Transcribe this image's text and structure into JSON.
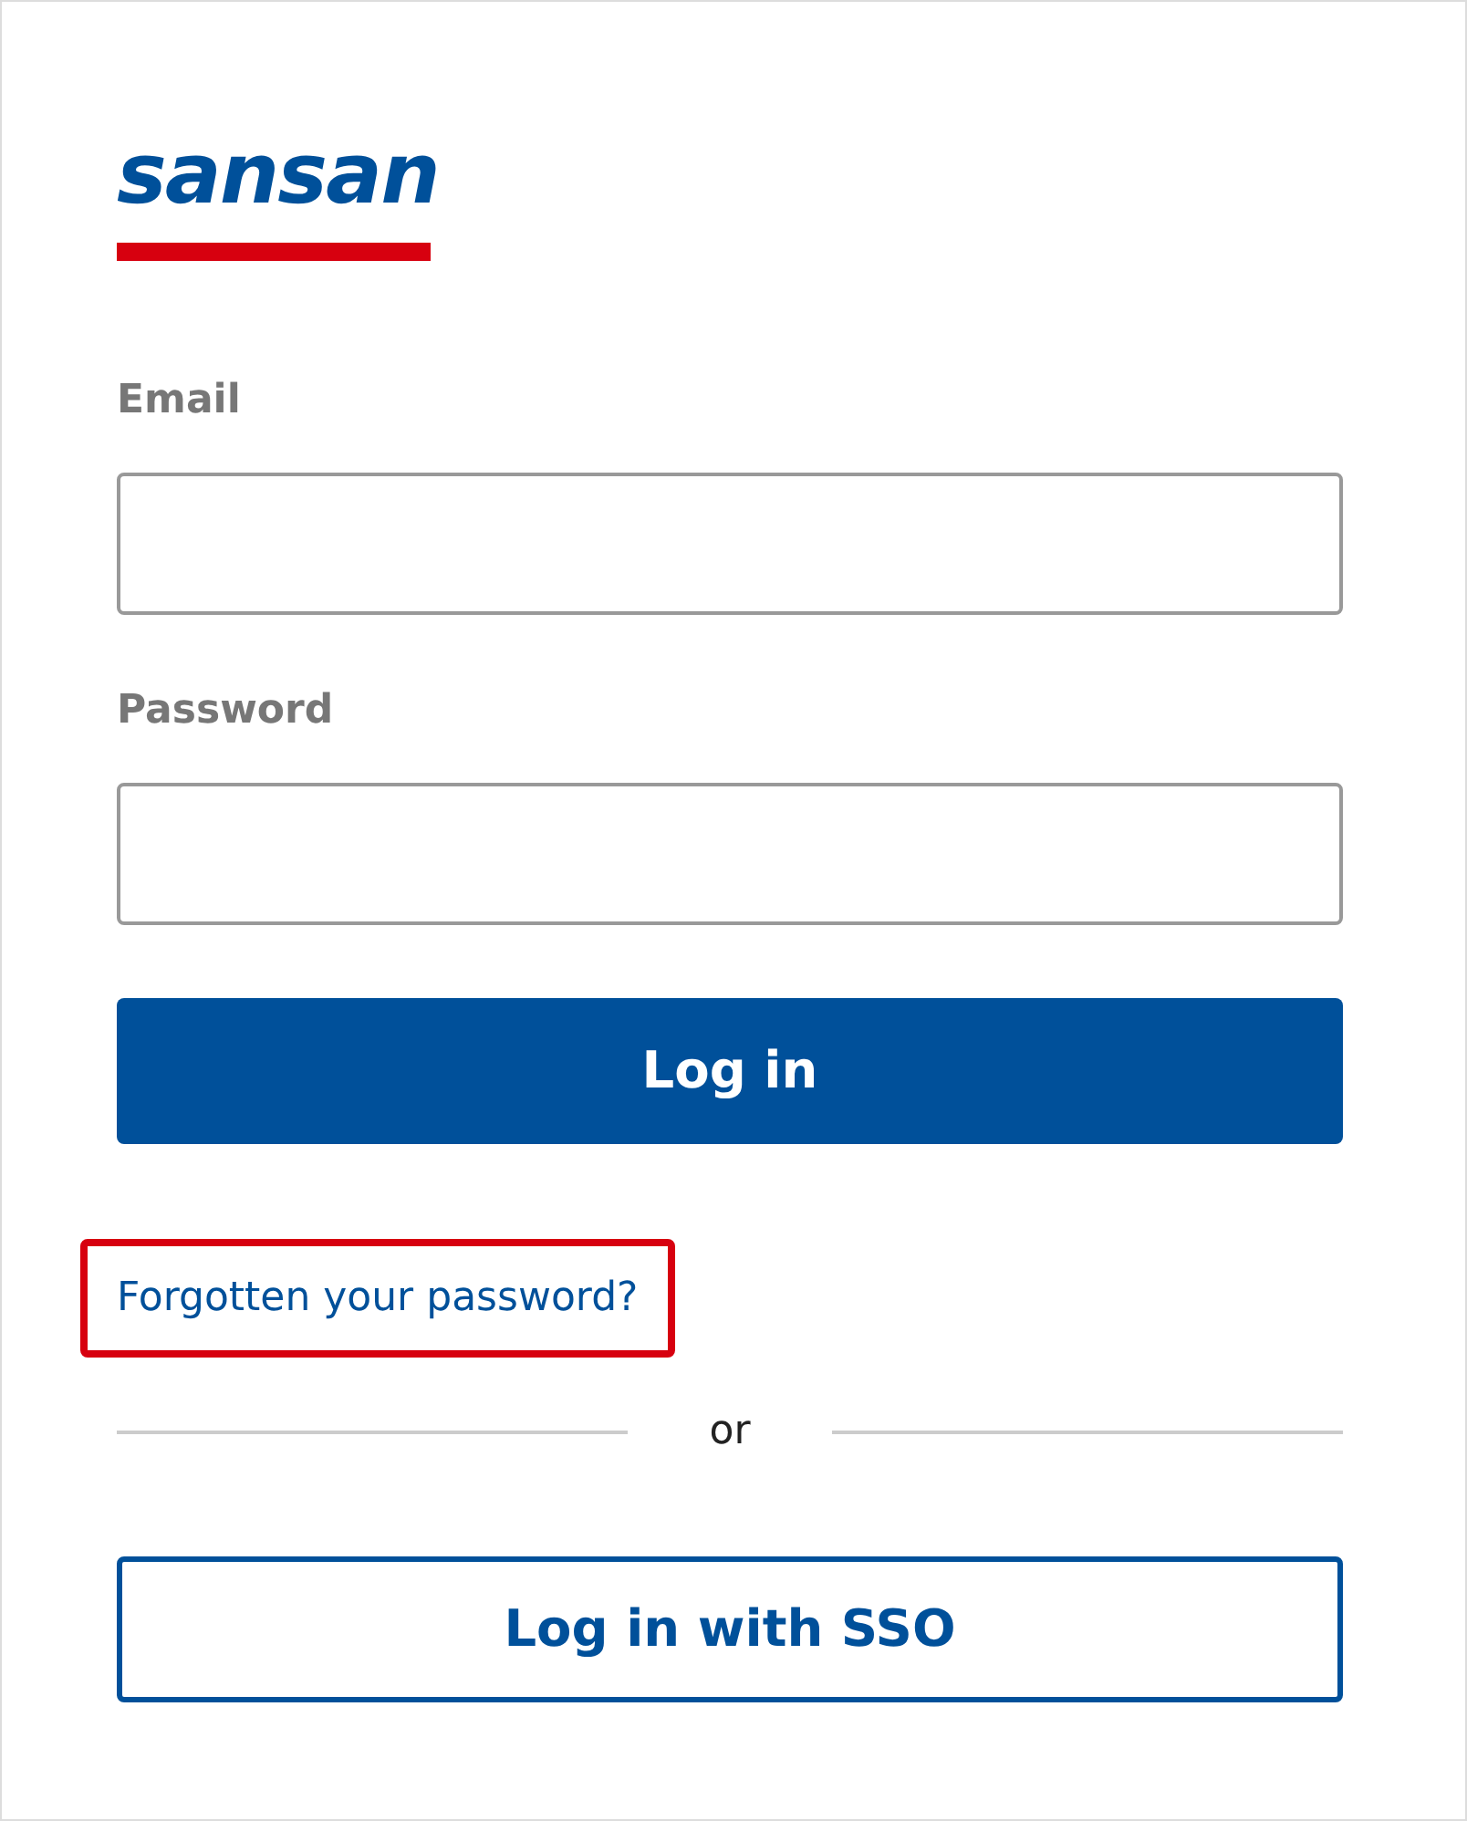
{
  "logo": {
    "text": "sansan"
  },
  "fields": [
    {
      "label": "Email"
    },
    {
      "label": "Password"
    }
  ],
  "login_button": {
    "label": "Log in"
  },
  "forgot_link": {
    "label": "Forgotten your password?",
    "highlighted": true
  },
  "divider": {
    "label": "or"
  },
  "sso_button": {
    "label": "Log in with SSO"
  }
}
